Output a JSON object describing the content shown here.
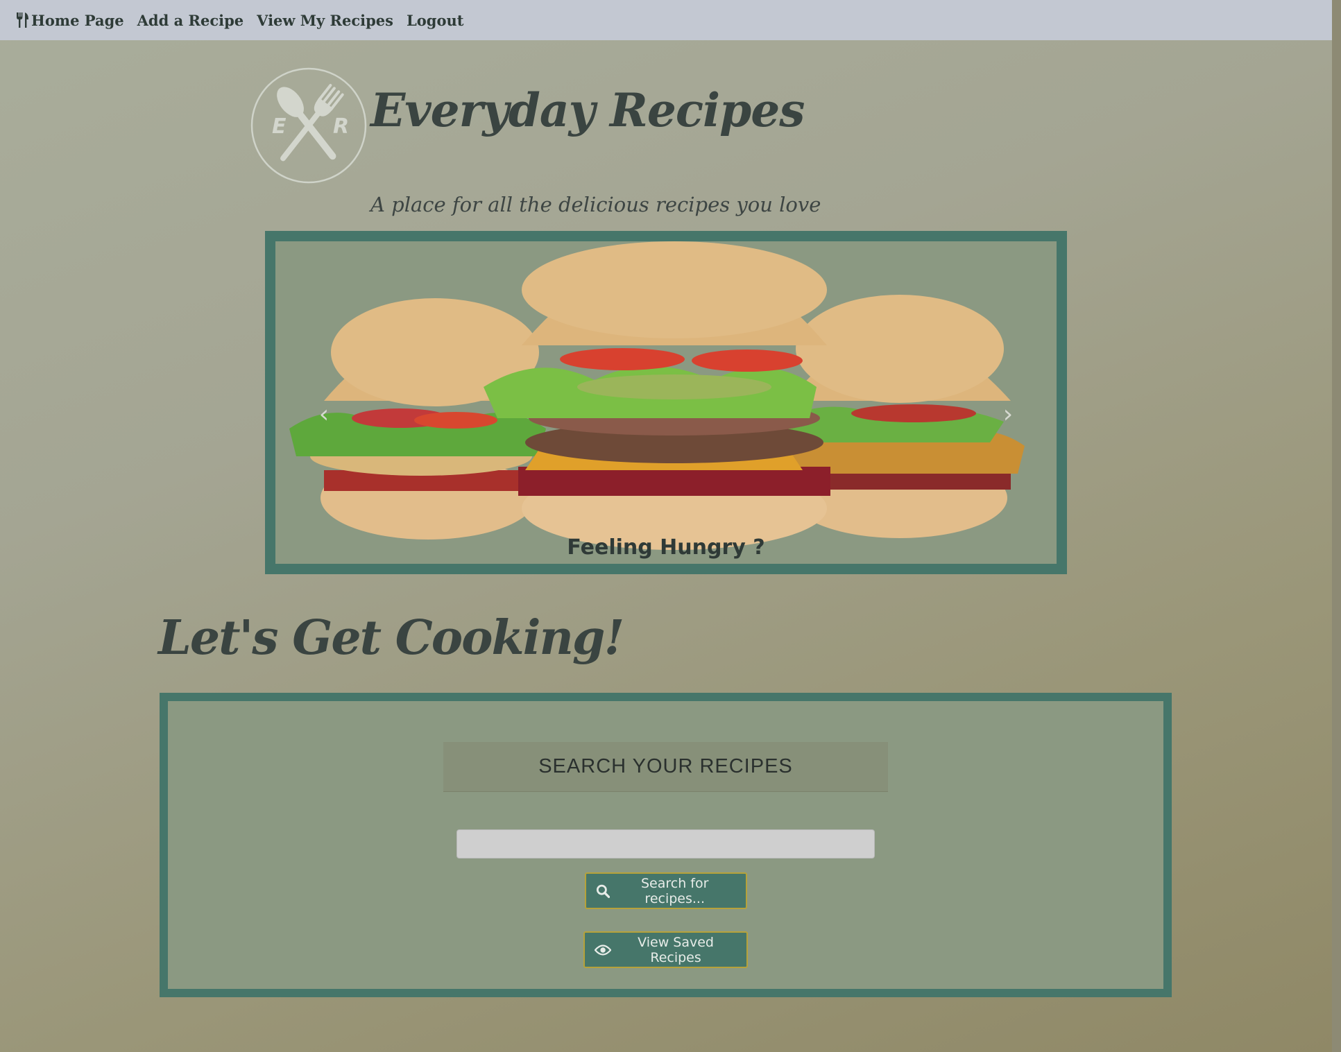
{
  "navbar": {
    "items": [
      {
        "label": "Home Page",
        "icon": "utensils-icon"
      },
      {
        "label": "Add a Recipe"
      },
      {
        "label": "View My Recipes"
      },
      {
        "label": "Logout"
      }
    ]
  },
  "header": {
    "logo": {
      "letters": [
        "E",
        "R"
      ],
      "icon": "spoon-fork-crossed-icon"
    },
    "title": "Everyday Recipes",
    "tagline": "A place for all the delicious recipes you love"
  },
  "carousel": {
    "caption": "Feeling Hungry ?",
    "prev_icon": "chevron-left-icon",
    "next_icon": "chevron-right-icon",
    "prev_glyph": "‹",
    "next_glyph": "›"
  },
  "main": {
    "heading": "Let's Get Cooking!",
    "search": {
      "header": "SEARCH YOUR RECIPES",
      "input_value": "",
      "search_button": "Search for recipes...",
      "search_icon": "search-icon",
      "saved_button": "View Saved Recipes",
      "saved_icon": "eye-icon"
    }
  },
  "colors": {
    "navbar_bg": "#c3c8d2",
    "panel_border": "#46766a",
    "panel_bg": "#8b9982",
    "button_bg": "#46766a",
    "button_border": "#b6a23a",
    "text_dark": "#3a4441"
  }
}
